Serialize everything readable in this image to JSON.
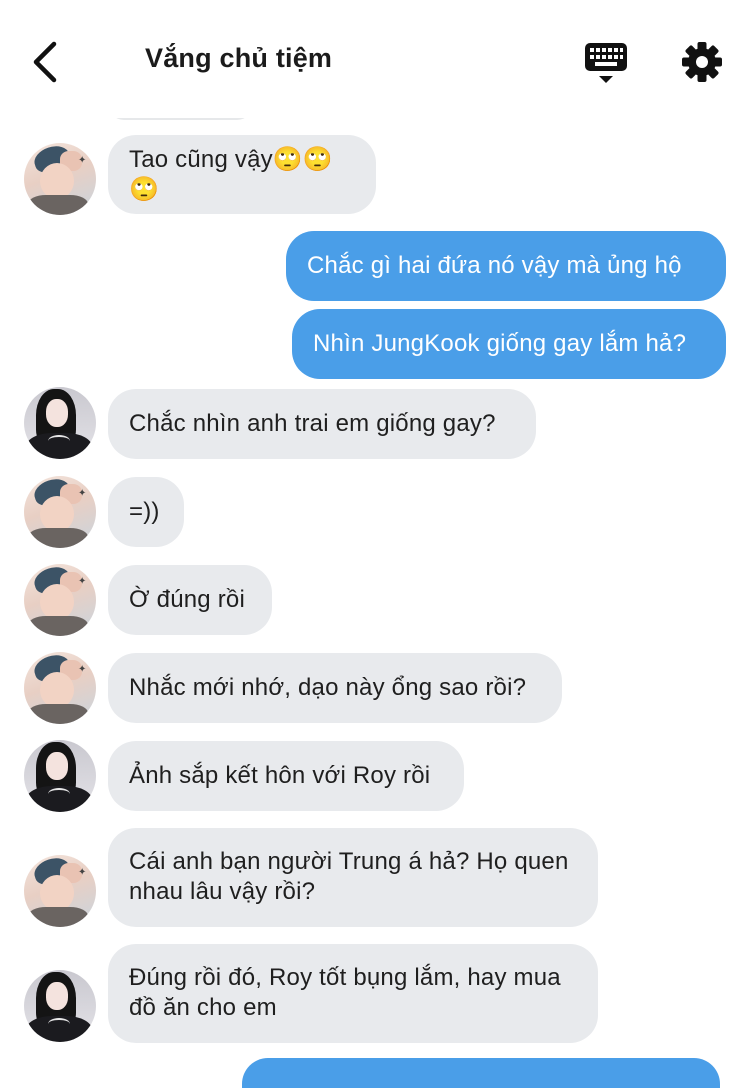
{
  "header": {
    "title": "Vắng chủ tiệm"
  },
  "icons": {
    "back": "chevron-left-icon",
    "keyboard": "keyboard-icon",
    "settings": "gear-icon"
  },
  "colors": {
    "outgoing_bubble": "#4a9ee8",
    "incoming_bubble": "#e8eaed"
  },
  "messages": [
    {
      "sender": "a",
      "text": "Tao cũng vậy🙄🙄🙄"
    },
    {
      "sender": "me",
      "text": "Chắc gì hai đứa nó vậy mà ủng hộ"
    },
    {
      "sender": "me",
      "text": "Nhìn JungKook giống gay lắm hả?"
    },
    {
      "sender": "b",
      "text": "Chắc nhìn anh trai em giống gay?"
    },
    {
      "sender": "a",
      "text": "=))"
    },
    {
      "sender": "a",
      "text": "Ờ đúng rồi"
    },
    {
      "sender": "a",
      "text": "Nhắc mới nhớ, dạo này ổng sao rồi?"
    },
    {
      "sender": "b",
      "text": "Ảnh sắp kết hôn với Roy rồi"
    },
    {
      "sender": "a",
      "text": "Cái anh bạn người Trung á hả? Họ quen nhau lâu vậy rồi?"
    },
    {
      "sender": "b",
      "text": "Đúng rồi đó, Roy tốt bụng lắm, hay mua đồ ăn cho em"
    }
  ]
}
